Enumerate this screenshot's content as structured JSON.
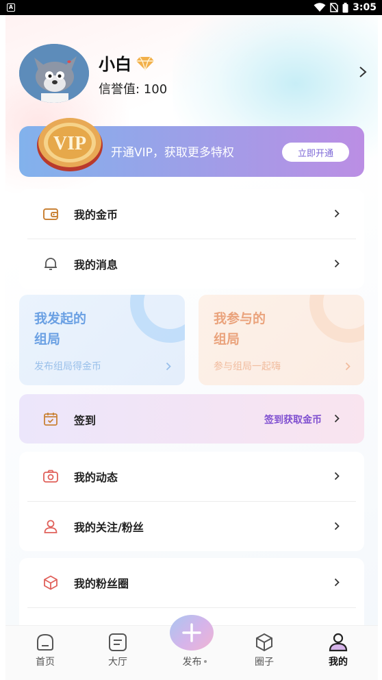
{
  "status_bar": {
    "badge": "A",
    "time": "3:05"
  },
  "profile": {
    "name": "小白",
    "reputation": "信誉值: 100"
  },
  "vip": {
    "text": "开通VIP，获取更多特权",
    "button": "立即开通",
    "coin_label": "VIP"
  },
  "menu_top": [
    {
      "label": "我的金币",
      "icon": "wallet-icon"
    },
    {
      "label": "我的消息",
      "icon": "bell-icon"
    }
  ],
  "tiles": {
    "initiated": {
      "title_line1": "我发起的",
      "title_line2": "组局",
      "subtitle": "发布组局得金币"
    },
    "joined": {
      "title_line1": "我参与的",
      "title_line2": "组局",
      "subtitle": "参与组局一起嗨"
    }
  },
  "signin": {
    "label": "签到",
    "link": "签到获取金币"
  },
  "menu_mid": [
    {
      "label": "我的动态",
      "icon": "camera-icon"
    },
    {
      "label": "我的关注/粉丝",
      "icon": "person-icon"
    }
  ],
  "menu_bottom": [
    {
      "label": "我的粉丝圈",
      "icon": "cube-icon"
    }
  ],
  "nav": {
    "home": "首页",
    "hall": "大厅",
    "publish": "发布",
    "circle": "圈子",
    "mine": "我的"
  },
  "colors": {
    "accent_purple": "#7f4fd0",
    "icon_red": "#e0605a",
    "tile_blue": "#6aa0e3",
    "tile_orange": "#eaa37c"
  }
}
